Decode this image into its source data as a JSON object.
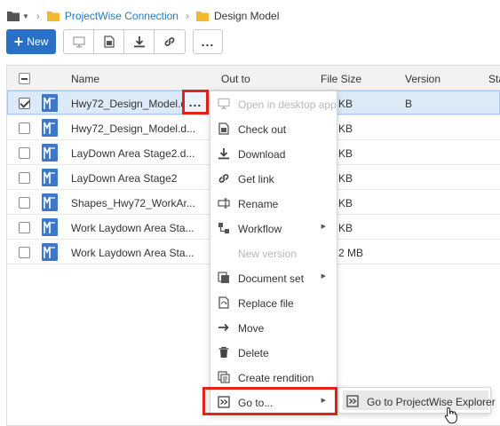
{
  "breadcrumb": {
    "root_icon": "folder-icon",
    "link": "ProjectWise Connection",
    "current": "Design Model"
  },
  "toolbar": {
    "new_label": "New",
    "more_label": "..."
  },
  "table": {
    "columns": [
      "Name",
      "Out to",
      "File Size",
      "Version",
      "Sta"
    ],
    "rows": [
      {
        "name": "Hwy72_Design_Model.d...",
        "size": "KB",
        "version": "B",
        "selected": true
      },
      {
        "name": "Hwy72_Design_Model.d...",
        "size": "KB",
        "version": ""
      },
      {
        "name": "LayDown Area Stage2.d...",
        "size": "KB",
        "version": ""
      },
      {
        "name": "LayDown Area Stage2",
        "size": "KB",
        "version": ""
      },
      {
        "name": "Shapes_Hwy72_WorkAr...",
        "size": "KB",
        "version": ""
      },
      {
        "name": "Work Laydown Area Sta...",
        "size": "KB",
        "version": ""
      },
      {
        "name": "Work Laydown Area Sta...",
        "size": "2 MB",
        "version": ""
      }
    ]
  },
  "context_menu": {
    "items": [
      {
        "label": "Open in desktop app",
        "icon": "monitor-icon",
        "disabled": true
      },
      {
        "label": "Check out",
        "icon": "check-out-icon"
      },
      {
        "label": "Download",
        "icon": "download-icon"
      },
      {
        "label": "Get link",
        "icon": "link-icon"
      },
      {
        "label": "Rename",
        "icon": "rename-icon"
      },
      {
        "label": "Workflow",
        "icon": "workflow-icon",
        "submenu": true
      },
      {
        "label": "New version",
        "icon": "",
        "disabled": true
      },
      {
        "label": "Document set",
        "icon": "document-set-icon",
        "submenu": true
      },
      {
        "label": "Replace file",
        "icon": "replace-file-icon"
      },
      {
        "label": "Move",
        "icon": "move-arrow-icon"
      },
      {
        "label": "Delete",
        "icon": "trash-icon"
      },
      {
        "label": "Create rendition",
        "icon": "rendition-icon"
      },
      {
        "label": "Go to...",
        "icon": "goto-icon",
        "submenu": true
      }
    ]
  },
  "submenu": {
    "item_label": "Go to ProjectWise Explorer",
    "item_icon": "goto-icon"
  },
  "colors": {
    "accent": "#2a70c7",
    "link": "#2a7ab8",
    "highlight_box": "#e2231a",
    "selected_row": "#dceaf8"
  }
}
